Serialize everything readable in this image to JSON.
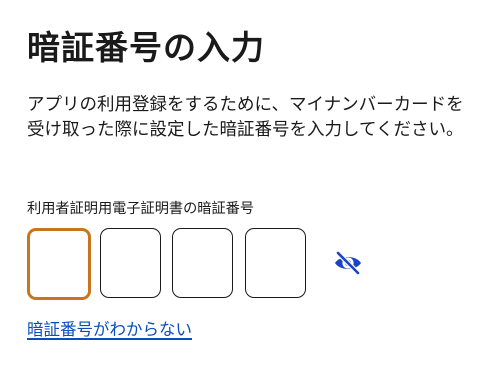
{
  "page": {
    "title": "暗証番号の入力",
    "description": "アプリの利用登録をするために、マイナンバーカードを受け取った際に設定した暗証番号を入力してください。"
  },
  "pin": {
    "label": "利用者証明用電子証明書の暗証番号",
    "digit_count": 4,
    "values": [
      "",
      "",
      "",
      ""
    ],
    "focused_index": 0,
    "visibility_icon": "eye-slash-icon"
  },
  "links": {
    "forgot_pin": "暗証番号がわからない"
  },
  "colors": {
    "focus_border": "#c8751e",
    "link": "#0a4dbd",
    "icon": "#1a44c6",
    "text": "#1a1a1a"
  }
}
